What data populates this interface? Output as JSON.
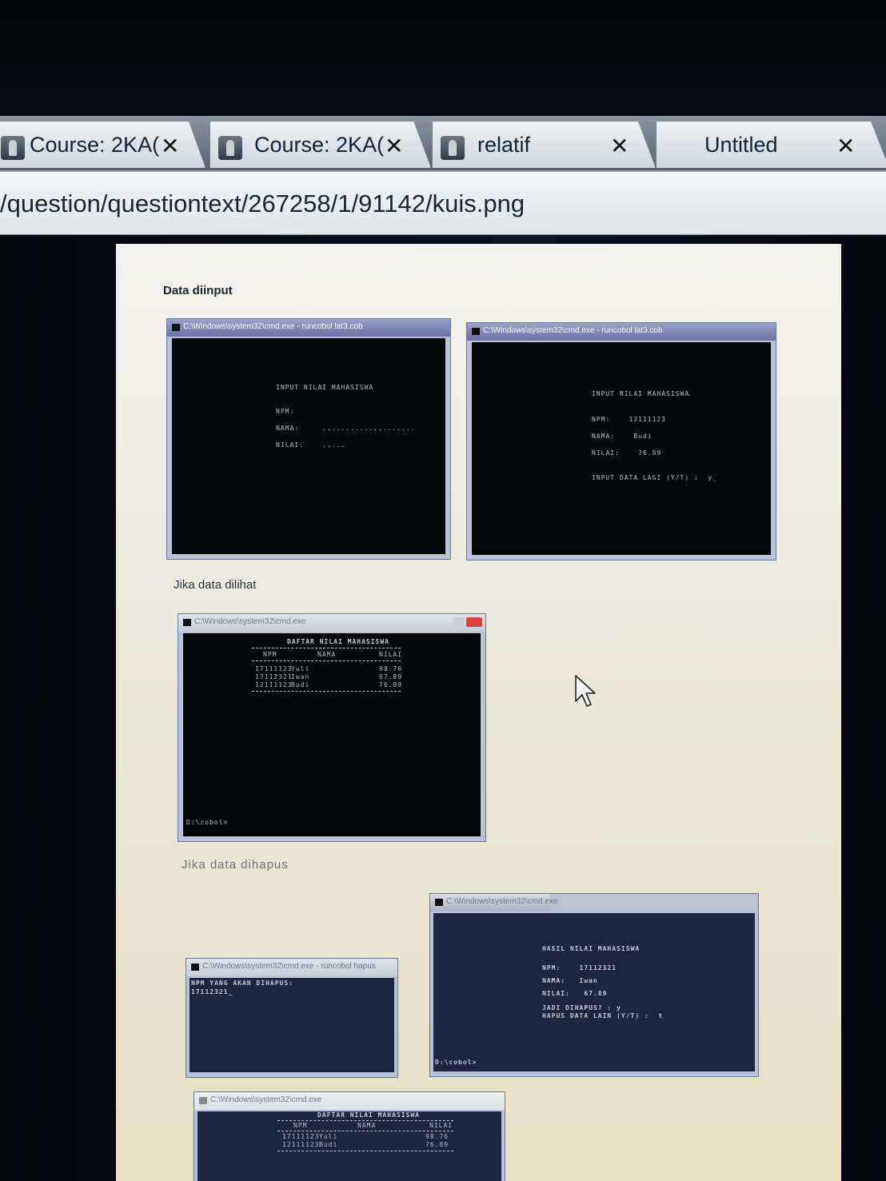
{
  "browser": {
    "tabs": [
      {
        "label": "Course: 2KA(",
        "close": "✕"
      },
      {
        "label": "Course: 2KA(",
        "close": "✕"
      },
      {
        "label": "relatif",
        "close": "✕"
      },
      {
        "label": "Untitled",
        "close": "✕"
      }
    ],
    "url": "/question/questiontext/267258/1/91142/kuis.png"
  },
  "doc": {
    "section1": "Data diinput",
    "section2": "Jika data dilihat",
    "section3": "Jika data dihapus",
    "win1": {
      "title": "C:\\Windows\\system32\\cmd.exe - runcobol lat3.cob",
      "heading": "INPUT NILAI MAHASISWA",
      "npm": "NPM:",
      "nama": "NAMA:     ....................",
      "nilai": "NILAI:    ....."
    },
    "win2": {
      "title": "C:\\Windows\\system32\\cmd.exe - runcobol lat3.cob",
      "heading": "INPUT NILAI MAHASISWA",
      "npm": "NPM:    12111123",
      "nama": "NAMA:    Budi",
      "nilai": "NILAI:    76.89",
      "prompt": "INPUT DATA LAGI (Y/T) :  y_"
    },
    "win3": {
      "title": "C:\\Windows\\system32\\cmd.exe",
      "heading": "DAFTAR NILAI MAHASISWA",
      "cols": [
        "NPM",
        "NAMA",
        "NILAI"
      ],
      "rows": [
        [
          "17111123",
          "Yuli",
          "98.76"
        ],
        [
          "17112321",
          "Iwan",
          "67.89"
        ],
        [
          "12111123",
          "Budi",
          "76.89"
        ]
      ],
      "prompt": "D:\\cobol>"
    },
    "win4": {
      "title": "C:\\Windows\\system32\\cmd.exe - runcobol hapus",
      "line1": "NPM YANG AKAN DIHAPUS:",
      "line2": "17112321_"
    },
    "win5": {
      "title": "C:\\Windows\\system32\\cmd.exe",
      "heading": "HASIL NILAI MAHASISWA",
      "npm": "NPM:    17112321",
      "nama": "NAMA:   Iwan",
      "nilai": "NILAI:   67.89",
      "q1": "JADI DIHAPUS? : y",
      "q2": "HAPUS DATA LAIN (Y/T) :  t",
      "prompt": "D:\\cobol>"
    },
    "win6": {
      "title": "C:\\Windows\\system32\\cmd.exe",
      "heading": "DAFTAR NILAI MAHASISWA",
      "cols": [
        "NPM",
        "NAMA",
        "NILAI"
      ],
      "rows": [
        [
          "17111123",
          "Yuli",
          "98.76"
        ],
        [
          "12111123",
          "Budi",
          "76.89"
        ]
      ]
    }
  }
}
